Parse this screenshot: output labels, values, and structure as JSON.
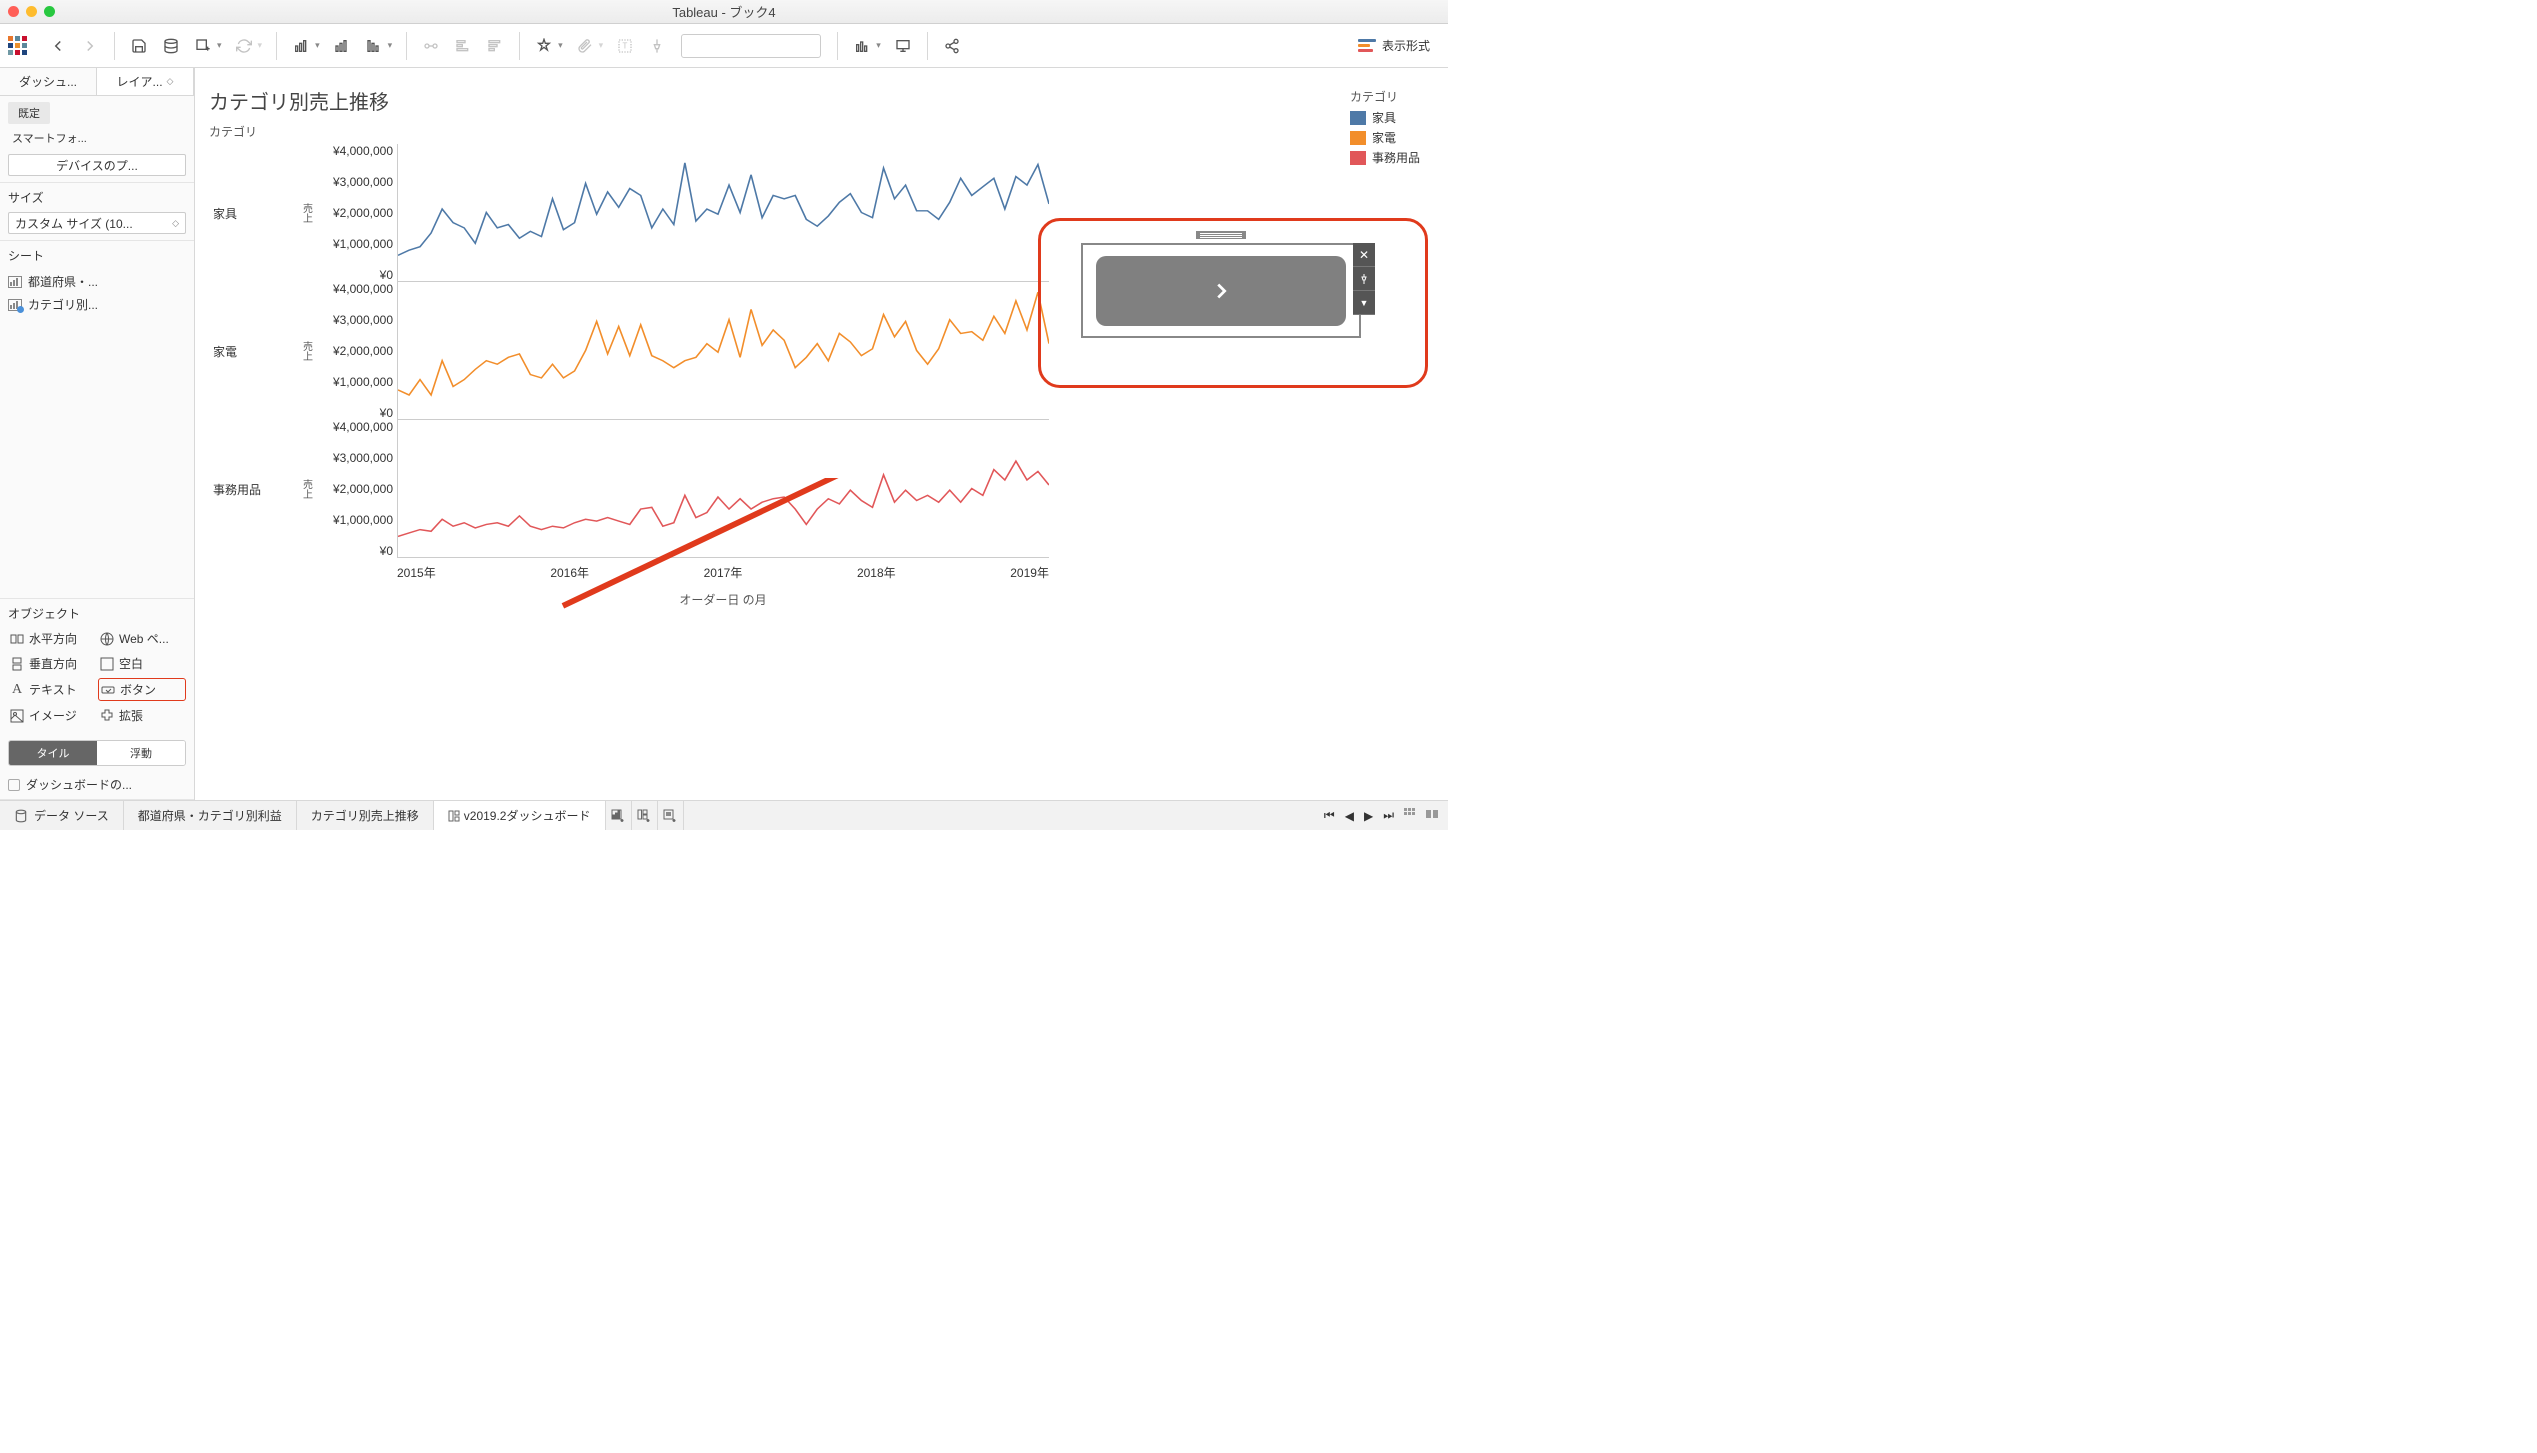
{
  "window": {
    "title": "Tableau - ブック4"
  },
  "toolbar": {
    "showme_label": "表示形式"
  },
  "sidebar": {
    "tabs": [
      "ダッシュ...",
      "レイア..."
    ],
    "preset": "既定",
    "smartphone": "スマートフォ...",
    "device_btn": "デバイスのプ...",
    "size_title": "サイズ",
    "size_value": "カスタム サイズ (10...",
    "sheets_title": "シート",
    "sheets": [
      "都道府県・...",
      "カテゴリ別..."
    ],
    "objects_title": "オブジェクト",
    "objects": [
      {
        "icon": "h",
        "label": "水平方向"
      },
      {
        "icon": "web",
        "label": "Web ペ..."
      },
      {
        "icon": "v",
        "label": "垂直方向"
      },
      {
        "icon": "blank",
        "label": "空白"
      },
      {
        "icon": "text",
        "label": "テキスト"
      },
      {
        "icon": "btn",
        "label": "ボタン"
      },
      {
        "icon": "img",
        "label": "イメージ"
      },
      {
        "icon": "ext",
        "label": "拡張"
      }
    ],
    "toggle": [
      "タイル",
      "浮動"
    ],
    "cb_label": "ダッシュボードの..."
  },
  "chart": {
    "title": "カテゴリ別売上推移",
    "subtitle": "カテゴリ",
    "ylab": "売上",
    "xlab": "オーダー日 の月",
    "legend_title": "カテゴリ",
    "legend": [
      {
        "label": "家具",
        "color": "#4e79a7"
      },
      {
        "label": "家電",
        "color": "#f28e2b"
      },
      {
        "label": "事務用品",
        "color": "#e15759"
      }
    ]
  },
  "chart_data": {
    "type": "line",
    "facets": [
      "家具",
      "家電",
      "事務用品"
    ],
    "ylabel": "売上",
    "yticks": [
      "¥4,000,000",
      "¥3,000,000",
      "¥2,000,000",
      "¥1,000,000",
      "¥0"
    ],
    "ylim": [
      0,
      4000000
    ],
    "xlabel": "オーダー日 の月",
    "xticks": [
      "2015年",
      "2016年",
      "2017年",
      "2018年",
      "2019年"
    ],
    "x": [
      "2014-01",
      "2014-02",
      "2014-03",
      "2014-04",
      "2014-05",
      "2014-06",
      "2014-07",
      "2014-08",
      "2014-09",
      "2014-10",
      "2014-11",
      "2014-12",
      "2015-01",
      "2015-02",
      "2015-03",
      "2015-04",
      "2015-05",
      "2015-06",
      "2015-07",
      "2015-08",
      "2015-09",
      "2015-10",
      "2015-11",
      "2015-12",
      "2016-01",
      "2016-02",
      "2016-03",
      "2016-04",
      "2016-05",
      "2016-06",
      "2016-07",
      "2016-08",
      "2016-09",
      "2016-10",
      "2016-11",
      "2016-12",
      "2017-01",
      "2017-02",
      "2017-03",
      "2017-04",
      "2017-05",
      "2017-06",
      "2017-07",
      "2017-08",
      "2017-09",
      "2017-10",
      "2017-11",
      "2017-12",
      "2018-01",
      "2018-02",
      "2018-03",
      "2018-04",
      "2018-05",
      "2018-06",
      "2018-07",
      "2018-08",
      "2018-09",
      "2018-10",
      "2018-11",
      "2018-12"
    ],
    "series": [
      {
        "name": "家具",
        "color": "#4e79a7",
        "values": [
          750000,
          900000,
          1000000,
          1400000,
          2100000,
          1700000,
          1550000,
          1100000,
          2000000,
          1550000,
          1650000,
          1250000,
          1450000,
          1300000,
          2400000,
          1500000,
          1700000,
          2850000,
          1950000,
          2600000,
          2150000,
          2700000,
          2500000,
          1550000,
          2100000,
          1650000,
          3450000,
          1750000,
          2100000,
          1950000,
          2800000,
          2000000,
          3100000,
          1850000,
          2500000,
          2400000,
          2500000,
          1800000,
          1600000,
          1900000,
          2300000,
          2550000,
          2000000,
          1850000,
          3300000,
          2400000,
          2800000,
          2050000,
          2050000,
          1800000,
          2300000,
          3000000,
          2500000,
          2750000,
          3000000,
          2100000,
          3050000,
          2800000,
          3400000,
          2250000
        ]
      },
      {
        "name": "家電",
        "color": "#f28e2b",
        "values": [
          850000,
          700000,
          1150000,
          700000,
          1700000,
          950000,
          1150000,
          1450000,
          1700000,
          1600000,
          1800000,
          1900000,
          1300000,
          1200000,
          1600000,
          1200000,
          1400000,
          2000000,
          2850000,
          1900000,
          2700000,
          1850000,
          2750000,
          1850000,
          1700000,
          1500000,
          1700000,
          1800000,
          2200000,
          1950000,
          2900000,
          1800000,
          3200000,
          2150000,
          2600000,
          2300000,
          1500000,
          1800000,
          2200000,
          1700000,
          2500000,
          2250000,
          1850000,
          2050000,
          3050000,
          2400000,
          2850000,
          2000000,
          1600000,
          2050000,
          2900000,
          2500000,
          2550000,
          2300000,
          3000000,
          2500000,
          3450000,
          2600000,
          3700000,
          2200000
        ]
      },
      {
        "name": "事務用品",
        "color": "#e15759",
        "values": [
          600000,
          700000,
          800000,
          750000,
          1100000,
          900000,
          1000000,
          850000,
          950000,
          1000000,
          900000,
          1200000,
          900000,
          800000,
          900000,
          850000,
          1000000,
          1100000,
          1050000,
          1150000,
          1050000,
          950000,
          1400000,
          1450000,
          900000,
          1000000,
          1800000,
          1150000,
          1300000,
          1750000,
          1400000,
          1700000,
          1400000,
          1600000,
          1700000,
          1750000,
          1400000,
          950000,
          1400000,
          1700000,
          1550000,
          1950000,
          1650000,
          1450000,
          2400000,
          1600000,
          1950000,
          1650000,
          1800000,
          1600000,
          1950000,
          1600000,
          2000000,
          1800000,
          2550000,
          2250000,
          2800000,
          2250000,
          2500000,
          2100000
        ]
      }
    ]
  },
  "tabs": {
    "datasource": "データ ソース",
    "items": [
      "都道府県・カテゴリ別利益",
      "カテゴリ別売上推移",
      "v2019.2ダッシュボード"
    ]
  }
}
